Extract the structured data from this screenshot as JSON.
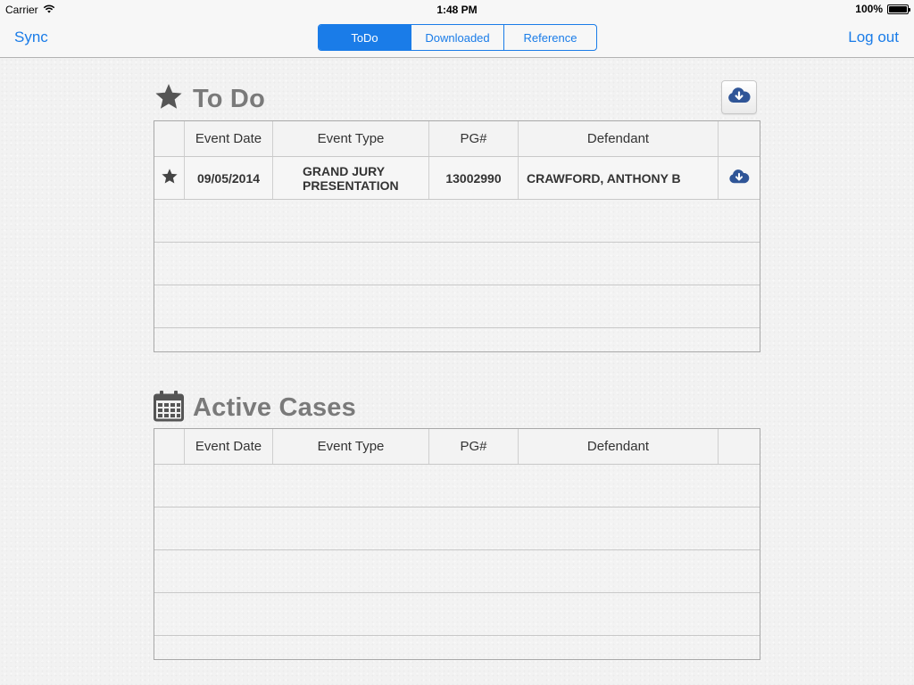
{
  "status_bar": {
    "carrier": "Carrier",
    "time": "1:48 PM",
    "battery": "100%",
    "battery_level": 1.0
  },
  "nav": {
    "left_button": "Sync",
    "right_button": "Log out",
    "segments": [
      {
        "label": "ToDo",
        "active": true
      },
      {
        "label": "Downloaded",
        "active": false
      },
      {
        "label": "Reference",
        "active": false
      }
    ]
  },
  "todo": {
    "title": "To Do",
    "icon": "star-icon",
    "columns": [
      "",
      "Event Date",
      "Event Type",
      "PG#",
      "Defendant",
      ""
    ],
    "rows": [
      {
        "event_date": "09/05/2014",
        "event_type": "GRAND JURY PRESENTATION",
        "pg": "13002990",
        "defendant": "CRAWFORD, ANTHONY B"
      }
    ]
  },
  "active_cases": {
    "title": "Active Cases",
    "icon": "calendar-icon",
    "columns": [
      "",
      "Event Date",
      "Event Type",
      "PG#",
      "Defendant",
      ""
    ],
    "rows": []
  },
  "colors": {
    "accent": "#1a7ce8",
    "section_title": "#7a7a7a",
    "download_icon": "#2f5597",
    "star": "#444444"
  }
}
